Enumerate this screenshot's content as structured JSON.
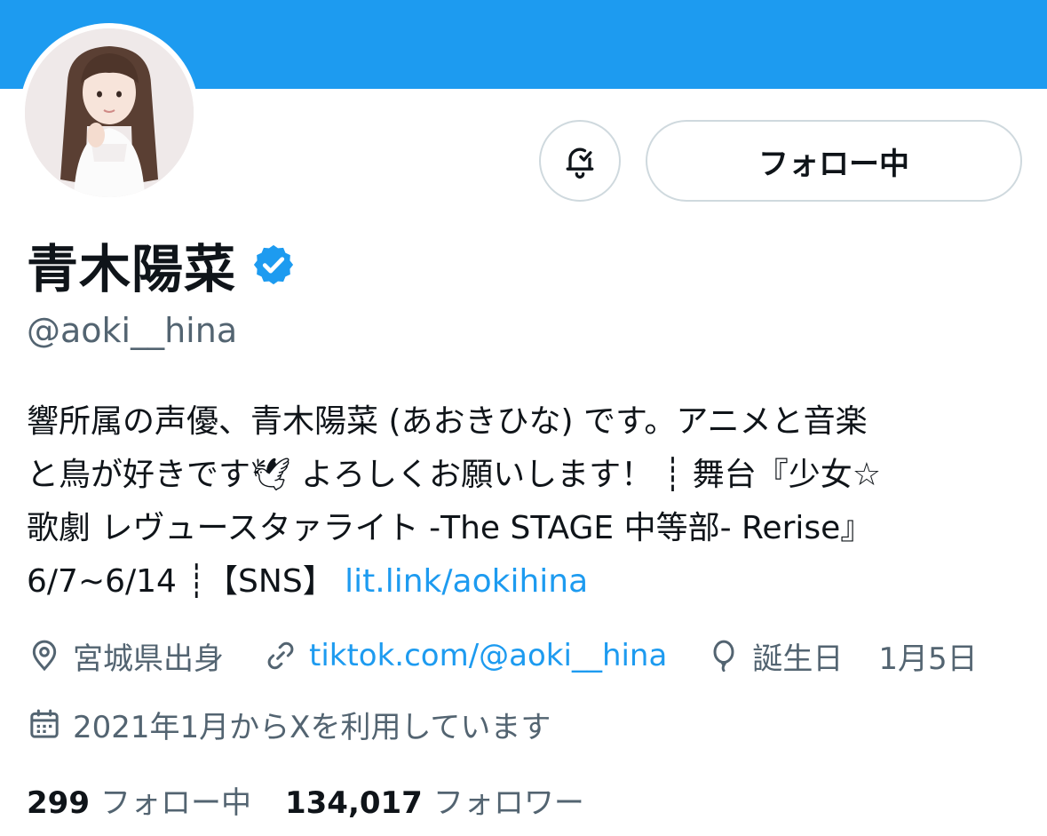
{
  "profile": {
    "display_name": "青木陽菜",
    "handle": "@aoki__hina",
    "bio": {
      "line1": "響所属の声優、青木陽菜 (あおきひな) です。アニメと音楽",
      "line2": "と鳥が好きです🕊 よろしくお願いします！ ┊ 舞台『少女☆",
      "line3": "歌劇 レヴュースタァライト -The STAGE 中等部- Rerise』",
      "line4_text": "6/7~6/14 ┊【SNS】",
      "line4_link": "lit.link/aokihina"
    },
    "location": "宮城県出身",
    "website": "tiktok.com/@aoki__hina",
    "birthday_label": "誕生日",
    "birthday_value": "1月5日",
    "joined": "2021年1月からXを利用しています"
  },
  "actions": {
    "follow_label": "フォロー中"
  },
  "stats": {
    "following_count": "299",
    "following_label": "フォロー中",
    "followers_count": "134,017",
    "followers_label": "フォロワー"
  },
  "icons": {
    "bell": "bell-check-icon",
    "verified": "verified-badge-icon",
    "location": "location-pin-icon",
    "link": "link-icon",
    "birthday": "balloon-icon",
    "calendar": "calendar-icon"
  },
  "colors": {
    "banner": "#1d9bf0",
    "accent": "#1d9bf0",
    "muted": "#536471",
    "text": "#0f1419",
    "border": "#cfd9de"
  }
}
